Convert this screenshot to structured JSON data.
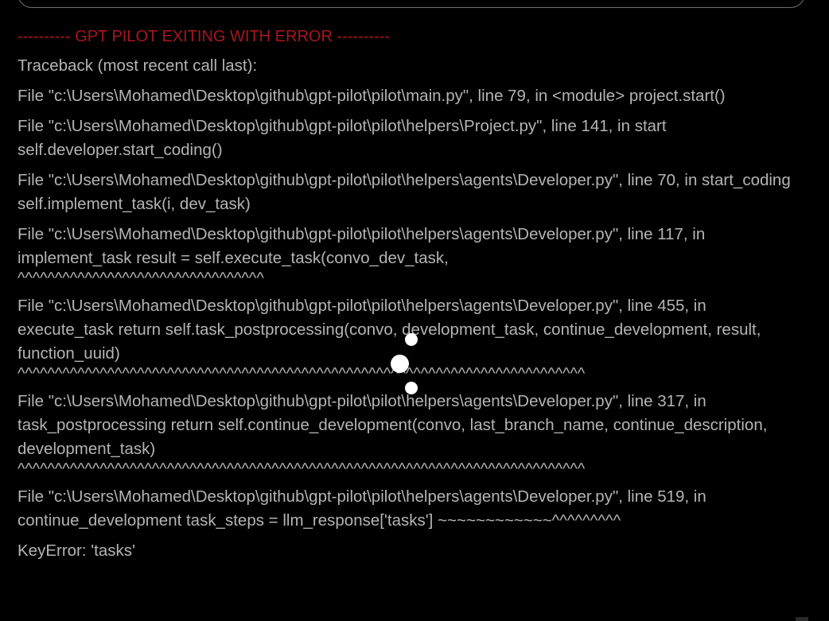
{
  "header": {
    "error_banner": "---------- GPT PILOT EXITING WITH ERROR ----------"
  },
  "traceback": {
    "title": "Traceback (most recent call last):",
    "frames": [
      {
        "text": "File \"c:\\Users\\Mohamed\\Desktop\\github\\gpt-pilot\\pilot\\main.py\", line 79, in <module> project.start()",
        "carets": ""
      },
      {
        "text": "File \"c:\\Users\\Mohamed\\Desktop\\github\\gpt-pilot\\pilot\\helpers\\Project.py\", line 141, in start self.developer.start_coding()",
        "carets": ""
      },
      {
        "text": "File \"c:\\Users\\Mohamed\\Desktop\\github\\gpt-pilot\\pilot\\helpers\\agents\\Developer.py\", line 70, in start_coding self.implement_task(i, dev_task)",
        "carets": ""
      },
      {
        "text": "File \"c:\\Users\\Mohamed\\Desktop\\github\\gpt-pilot\\pilot\\helpers\\agents\\Developer.py\", line 117, in implement_task result = self.execute_task(convo_dev_task,",
        "carets": "^^^^^^^^^^^^^^^^^^^^^^^^^^^^^^^^^"
      },
      {
        "text": "File \"c:\\Users\\Mohamed\\Desktop\\github\\gpt-pilot\\pilot\\helpers\\agents\\Developer.py\", line 455, in execute_task return self.task_postprocessing(convo, development_task, continue_development, result, function_uuid)",
        "carets": "^^^^^^^^^^^^^^^^^^^^^^^^^^^^^^^^^^^^^^^^^^^^^^^^^^^^^^^^^^^^^^^^^^^^^^^^^^^^"
      },
      {
        "text": "File \"c:\\Users\\Mohamed\\Desktop\\github\\gpt-pilot\\pilot\\helpers\\agents\\Developer.py\", line 317, in task_postprocessing return self.continue_development(convo, last_branch_name, continue_description, development_task)",
        "carets": "^^^^^^^^^^^^^^^^^^^^^^^^^^^^^^^^^^^^^^^^^^^^^^^^^^^^^^^^^^^^^^^^^^^^^^^^^^^^"
      },
      {
        "text": "File \"c:\\Users\\Mohamed\\Desktop\\github\\gpt-pilot\\pilot\\helpers\\agents\\Developer.py\", line 519, in continue_development task_steps = llm_response['tasks'] ~~~~~~~~~~~~^^^^^^^^^",
        "carets": ""
      }
    ],
    "error": "KeyError: 'tasks'"
  },
  "colors": {
    "background": "#000000",
    "text": "#b4b4b4",
    "error_banner": "#a7161f",
    "loading_dots": "#ffffff"
  },
  "overlay": {
    "icon": "loading-spinner-icon"
  }
}
